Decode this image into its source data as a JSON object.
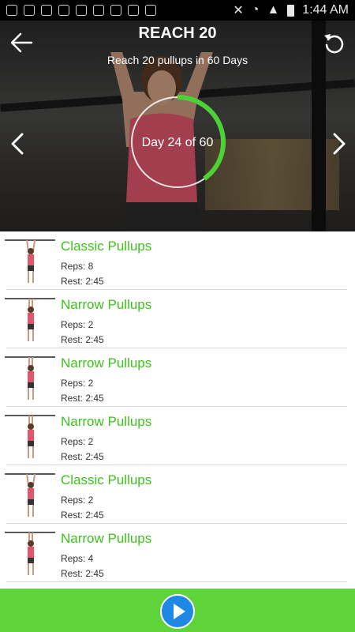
{
  "status_bar": {
    "time": "1:44 AM"
  },
  "header": {
    "title": "REACH 20",
    "subtitle": "Reach 20 pullups in 60 Days",
    "progress_label": "Day 24 of 60",
    "progress_fraction": 0.4
  },
  "exercises": [
    {
      "name": "Classic Pullups",
      "reps": "Reps: 8",
      "rest": "Rest: 2:45"
    },
    {
      "name": "Narrow Pullups",
      "reps": "Reps: 2",
      "rest": "Rest: 2:45"
    },
    {
      "name": "Narrow Pullups",
      "reps": "Reps: 2",
      "rest": "Rest: 2:45"
    },
    {
      "name": "Narrow Pullups",
      "reps": "Reps: 2",
      "rest": "Rest: 2:45"
    },
    {
      "name": "Classic Pullups",
      "reps": "Reps: 2",
      "rest": "Rest: 2:45"
    },
    {
      "name": "Narrow Pullups",
      "reps": "Reps: 4",
      "rest": "Rest: 2:45"
    }
  ],
  "colors": {
    "accent_green": "#5fd43a",
    "exercise_green": "#3ec21c",
    "play_blue": "#1e88e5"
  },
  "icons": {
    "back": "arrow-left-icon",
    "reset": "rotate-ccw-icon",
    "prev": "chevron-left-icon",
    "next": "chevron-right-icon",
    "play": "play-icon"
  }
}
